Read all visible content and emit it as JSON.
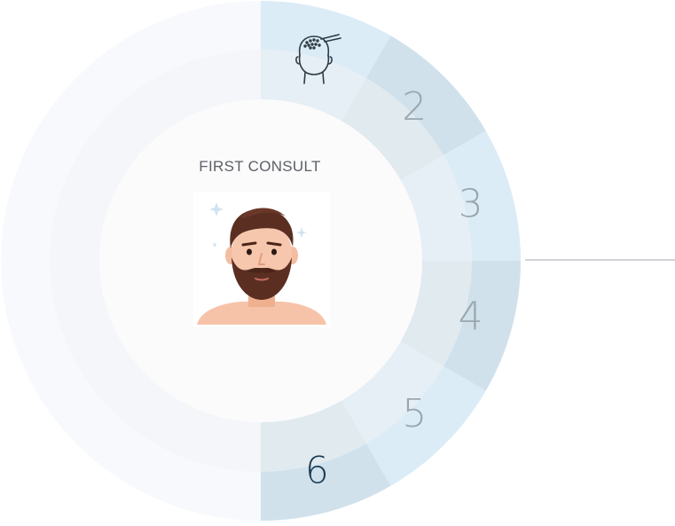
{
  "wheel": {
    "center_title": "FIRST CONSULT",
    "steps": [
      {
        "label": "",
        "icon": "head-transplant-icon",
        "color": "#dbecf7"
      },
      {
        "label": "2",
        "color": "#d0e1eb"
      },
      {
        "label": "3",
        "color": "#dbecf7"
      },
      {
        "label": "4",
        "color": "#d0e1eb"
      },
      {
        "label": "5",
        "color": "#dbecf7"
      },
      {
        "label": "6",
        "color": "#d0e1eb",
        "active": true
      }
    ],
    "colors": {
      "outer_ring": "#f7f9fc",
      "inner_ring": "#f3f4f6",
      "center": "#fbfbfc",
      "number": "#9aa6ad",
      "active_number": "#1c3c55",
      "connector": "#a0a7ac"
    }
  },
  "avatar": {
    "icon": "bearded-man-avatar"
  }
}
